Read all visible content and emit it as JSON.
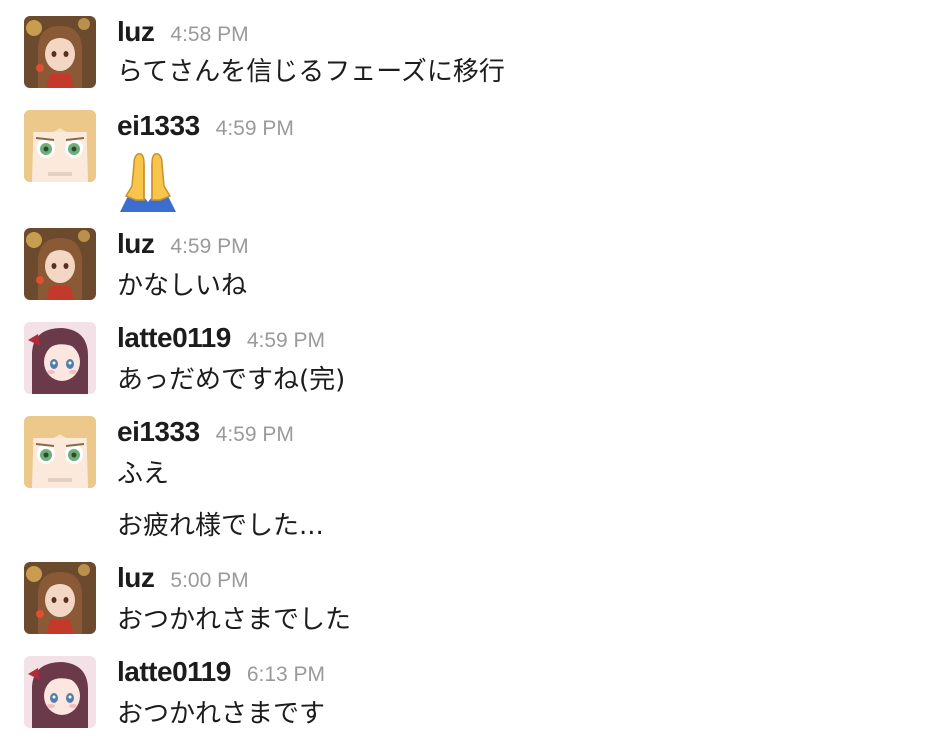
{
  "avatar_colors": {
    "luz": {
      "bg": "#6b4a2e",
      "hair": "#8a5a36",
      "skin": "#f3d7c4",
      "accent": "#c43a2a",
      "glow": "#f0c060"
    },
    "ei1333": {
      "bg": "#f6e6c4",
      "hair": "#ecc98a",
      "skin": "#fbe9dc",
      "eye": "#6fae7a"
    },
    "latte0119": {
      "bg": "#f4e1e8",
      "hair": "#6b3a4a",
      "skin": "#fbe6e0",
      "eye": "#4f7fb0",
      "ribbon": "#b02a3a"
    }
  },
  "emoji_colors": {
    "hands": "#f8c54b",
    "sleeve": "#3a6fd0",
    "outline": "#c9902e"
  },
  "messages": [
    {
      "user": "luz",
      "time": "4:58 PM",
      "avatar": "luz-avatar",
      "lines": [
        "らてさんを信じるフェーズに移行"
      ]
    },
    {
      "user": "ei1333",
      "time": "4:59 PM",
      "avatar": "ei1333-avatar",
      "emoji": "folded-hands-emoji"
    },
    {
      "user": "luz",
      "time": "4:59 PM",
      "avatar": "luz-avatar",
      "lines": [
        "かなしいね"
      ]
    },
    {
      "user": "latte0119",
      "time": "4:59 PM",
      "avatar": "latte0119-avatar",
      "lines": [
        "あっだめですね(完)"
      ]
    },
    {
      "user": "ei1333",
      "time": "4:59 PM",
      "avatar": "ei1333-avatar",
      "lines": [
        "ふえ",
        "お疲れ様でした..."
      ]
    },
    {
      "user": "luz",
      "time": "5:00 PM",
      "avatar": "luz-avatar",
      "lines": [
        "おつかれさまでした"
      ]
    },
    {
      "user": "latte0119",
      "time": "6:13 PM",
      "avatar": "latte0119-avatar",
      "lines": [
        "おつかれさまです"
      ]
    }
  ]
}
